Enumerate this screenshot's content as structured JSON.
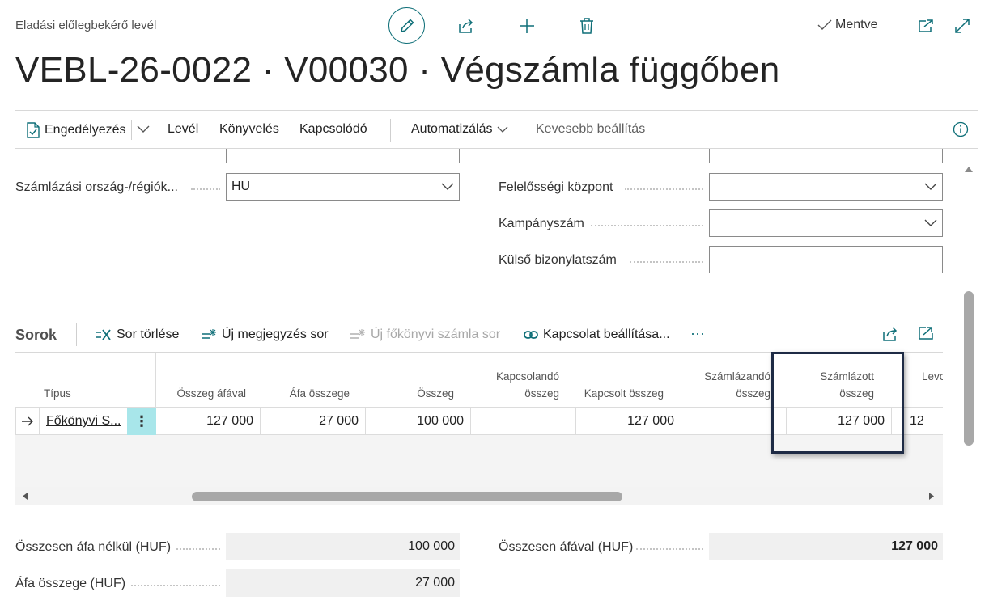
{
  "header": {
    "doc_type": "Eladási előlegbekérő levél",
    "title": "VEBL-26-0022 · V00030 · Végszámla függőben",
    "saved_label": "Mentve"
  },
  "actions": {
    "approve": "Engedélyezés",
    "letter": "Levél",
    "posting": "Könyvelés",
    "related": "Kapcsolódó",
    "automate": "Automatizálás",
    "fewer_options": "Kevesebb beállítás"
  },
  "fields": {
    "billing_country_label": "Számlázási ország-/régiók...",
    "billing_country_value": "HU",
    "responsibility_center_label": "Felelősségi központ",
    "responsibility_center_value": "",
    "campaign_no_label": "Kampányszám",
    "campaign_no_value": "",
    "external_doc_label": "Külső bizonylatszám",
    "external_doc_value": ""
  },
  "lines": {
    "title": "Sorok",
    "delete_line": "Sor törlése",
    "new_comment_line": "Új megjegyzés sor",
    "new_gl_line": "Új főkönyvi számla sor",
    "set_link": "Kapcsolat beállítása...",
    "more": "···",
    "columns": {
      "type": "Típus",
      "amount_incl_vat": "Összeg áfával",
      "vat_amount": "Áfa összege",
      "amount": "Összeg",
      "amount_to_link_1": "Kapcsolandó",
      "amount_to_link_2": "összeg",
      "linked_amount": "Kapcsolt összeg",
      "amount_to_invoice_1": "Számlázandó",
      "amount_to_invoice_2": "összeg",
      "invoiced_amount_1": "Számlázott",
      "invoiced_amount_2": "összeg",
      "next_cut": "Levo"
    },
    "row": {
      "type": "Főkönyvi S...",
      "amount_incl_vat": "127 000",
      "vat_amount": "27 000",
      "amount": "100 000",
      "amount_to_link": "",
      "linked_amount": "127 000",
      "amount_to_invoice": "",
      "invoiced_amount": "127 000",
      "next_cut": "12"
    }
  },
  "totals": {
    "total_excl_vat_label": "Összesen áfa nélkül (HUF)",
    "total_excl_vat_value": "100 000",
    "vat_amount_label": "Áfa összege (HUF)",
    "vat_amount_value": "27 000",
    "total_incl_vat_label": "Összesen áfával (HUF)",
    "total_incl_vat_value": "127 000"
  },
  "colors": {
    "accent": "#0f6f78",
    "highlight_frame": "#1e2b45",
    "row_menu_bg": "#a8e6ea"
  }
}
